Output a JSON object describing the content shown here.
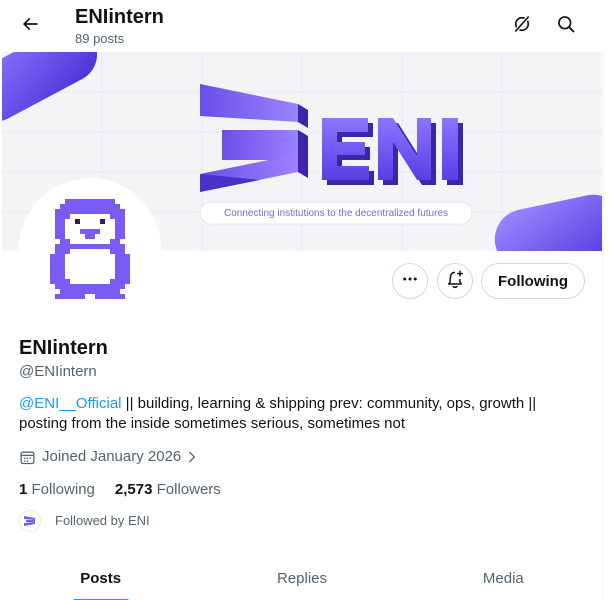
{
  "header": {
    "name": "ENIintern",
    "posts_count": "89 posts"
  },
  "banner": {
    "logo_text": "ENI",
    "tagline": "Connecting institutions to the decentralized futures",
    "brand_color": "#7b5cf0"
  },
  "actions": {
    "following_label": "Following"
  },
  "profile": {
    "display_name": "ENIintern",
    "handle": "@ENIintern",
    "bio_mention": "@ENI__Official",
    "bio_text": " || building, learning & shipping prev: community, ops, growth || posting from the inside sometimes serious, sometimes not",
    "joined": "Joined January 2026"
  },
  "stats": {
    "following_count": "1",
    "following_label": "Following",
    "followers_count": "2,573",
    "followers_label": "Followers"
  },
  "followed_by": {
    "text": "Followed by ENI"
  },
  "tabs": [
    {
      "label": "Posts",
      "active": true
    },
    {
      "label": "Replies",
      "active": false
    },
    {
      "label": "Media",
      "active": false
    }
  ],
  "colors": {
    "accent": "#1d9bf0",
    "text_primary": "#0f1419",
    "text_secondary": "#536471",
    "penguin_purple": "#7a5cf5"
  },
  "icons": {
    "back": "arrow-left-icon",
    "grok": "grok-icon",
    "search": "search-icon",
    "more": "more-dots-icon",
    "notify": "bell-plus-icon",
    "calendar": "calendar-icon",
    "chevron": "chevron-right-icon"
  }
}
